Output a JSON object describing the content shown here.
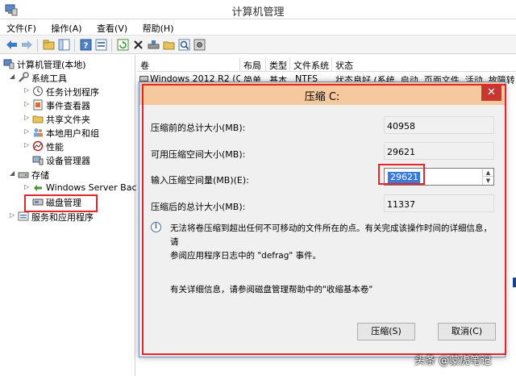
{
  "window": {
    "title": "计算机管理"
  },
  "menu": [
    "文件(F)",
    "操作(A)",
    "查看(V)",
    "帮助(H)"
  ],
  "toolbar": {
    "icons": [
      "back-icon",
      "forward-icon",
      "up-folder-icon",
      "show-hide-tree-icon",
      "help-icon",
      "properties-icon",
      "refresh-icon",
      "delete-icon",
      "map-drive-icon",
      "open-folder-icon",
      "zoom-icon",
      "settings-icon"
    ]
  },
  "tree": {
    "root": "计算机管理(本地)",
    "system_tools": "系统工具",
    "task_scheduler": "任务计划程序",
    "event_viewer": "事件查看器",
    "shared_folders": "共享文件夹",
    "local_users": "本地用户和组",
    "performance": "性能",
    "device_manager": "设备管理器",
    "storage": "存储",
    "windows_backup": "Windows Server Back",
    "disk_management": "磁盘管理",
    "services_apps": "服务和应用程序"
  },
  "list": {
    "columns": [
      "卷",
      "布局",
      "类型",
      "文件系统",
      "状态"
    ],
    "rows": [
      {
        "volume": "Windows 2012 R2 (C:)",
        "layout": "简单",
        "type": "基本",
        "fs": "NTFS",
        "status": "状态良好 (系统, 启动, 页面文件, 活动, 故障转储, 主分区)"
      }
    ]
  },
  "dialog": {
    "title": "压缩 C:",
    "close": "✕",
    "total_before_label": "压缩前的总计大小(MB):",
    "total_before_value": "40958",
    "available_label": "可用压缩空间大小(MB):",
    "available_value": "29621",
    "input_label": "输入压缩空间量(MB)(E):",
    "input_value": "29621",
    "total_after_label": "压缩后的总计大小(MB):",
    "total_after_value": "11337",
    "info_line1": "无法将卷压缩到超出任何不可移动的文件所在的点。有关完成该操作时间的详细信息，请",
    "info_line2": "参阅应用程序日志中的 \"defrag\" 事件。",
    "help_text": "有关详细信息，请参阅磁盘管理帮助中的\"收缩基本卷\"",
    "shrink_button": "压缩(S)",
    "cancel_button": "取消(C)"
  },
  "watermark": "头条 @蒙虎笔记",
  "colors": {
    "highlight": "#e3262c",
    "selection": "#3a7ad8",
    "dialog_title": "#f5c89e",
    "close": "#c7372f"
  }
}
